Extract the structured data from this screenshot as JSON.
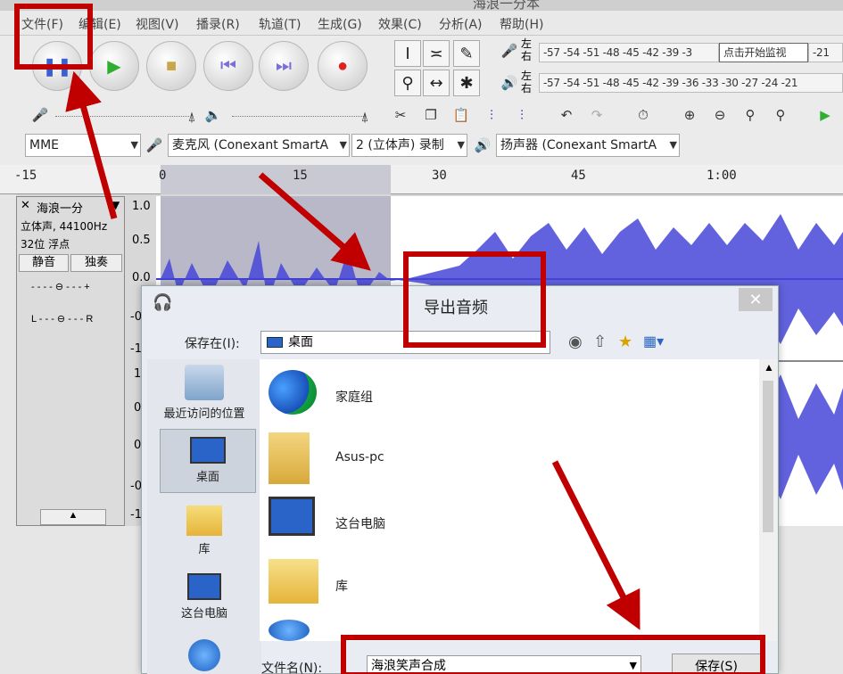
{
  "window": {
    "title": "海浪一分本"
  },
  "menu": [
    "文件(F)",
    "编辑(E)",
    "视图(V)",
    "播录(R)",
    "轨道(T)",
    "生成(G)",
    "效果(C)",
    "分析(A)",
    "帮助(H)"
  ],
  "meter": {
    "record_scale": "-57 -54 -51 -48 -45 -42 -39 -3",
    "monitor_label": "点击开始监视",
    "record_tail": "-21",
    "play_scale": "-57 -54 -51 -48 -45 -42 -39 -36 -33 -30 -27 -24 -21",
    "left_right": "左右"
  },
  "devices": {
    "host": "MME",
    "mic": "麦克风 (Conexant SmartA",
    "channels": "2 (立体声) 录制",
    "speaker": "扬声器 (Conexant SmartA"
  },
  "timeline": {
    "ticks": [
      "-15",
      "0",
      "15",
      "30",
      "45",
      "1:00"
    ]
  },
  "track": {
    "name": "海浪一分",
    "info1": "立体声, 44100Hz",
    "info2": "32位 浮点",
    "mute": "静音",
    "solo": "独奏",
    "scale_top": [
      "1.0",
      "0.5",
      "0.0",
      "-0",
      "-1"
    ],
    "scale_bottom": [
      "1",
      "0",
      "0",
      "-0",
      "-1"
    ]
  },
  "dialog": {
    "title": "导出音频",
    "save_in_label": "保存在(I):",
    "save_in_value": "桌面",
    "places": [
      "最近访问的位置",
      "桌面",
      "库",
      "这台电脑"
    ],
    "files": [
      "家庭组",
      "Asus-pc",
      "这台电脑",
      "库"
    ],
    "filename_label": "文件名(N):",
    "filename_value": "海浪笑声合成",
    "save_button": "保存(S)",
    "close": "✕"
  },
  "colors": {
    "annotation": "#c00000",
    "wave": "#3b3bd8",
    "selection": "#b8b8c8"
  }
}
